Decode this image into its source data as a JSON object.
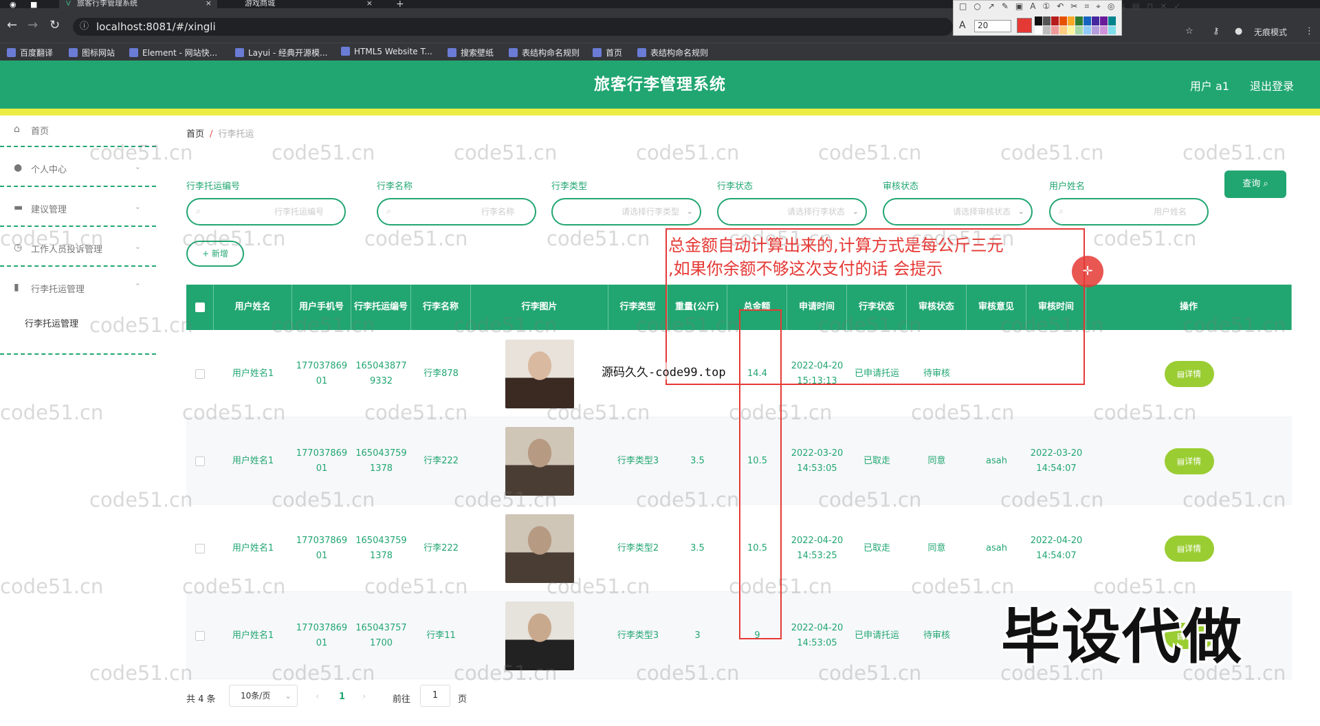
{
  "browser": {
    "tabs": [
      {
        "label": "旅客行李管理系统"
      },
      {
        "label": "游戏商城"
      }
    ],
    "tab_close": "×",
    "new_tab": "+",
    "url": "localhost:8081/#/xingli",
    "incognito_label": "无痕模式",
    "annot_font_size": "20",
    "annot_swatches": [
      "#111111",
      "#555555",
      "#b71c1c",
      "#e65100",
      "#f9a825",
      "#2e7d32",
      "#1565c0",
      "#4527a0",
      "#6a1b9a",
      "#00838f",
      "#ffffff",
      "#bdbdbd",
      "#ef9a9a",
      "#ffcc80",
      "#fff59d",
      "#a5d6a7",
      "#90caf9",
      "#b39ddb",
      "#ce93d8",
      "#80deea"
    ],
    "bookmarks": [
      "百度翻译",
      "图标网站",
      "Element - 网站快...",
      "Layui - 经典开源模...",
      "HTML5 Website T...",
      "搜索壁纸",
      "表结构命名规则",
      "首页",
      "表结构命名规则"
    ]
  },
  "header": {
    "title": "旅客行李管理系统",
    "user": "用户 a1",
    "logout": "退出登录"
  },
  "sidebar": {
    "items": [
      {
        "label": "首页"
      },
      {
        "label": "个人中心"
      },
      {
        "label": "建议管理"
      },
      {
        "label": "工作人员投诉管理"
      },
      {
        "label": "行李托运管理"
      }
    ],
    "subitem": "行李托运管理"
  },
  "breadcrumb": {
    "home": "首页",
    "sep": "/",
    "current": "行李托运"
  },
  "filters": [
    {
      "label": "行李托运编号",
      "placeholder": "行李托运编号"
    },
    {
      "label": "行李名称",
      "placeholder": "行李名称"
    },
    {
      "label": "行李类型",
      "placeholder": "请选择行李类型"
    },
    {
      "label": "行李状态",
      "placeholder": "请选择行李状态"
    },
    {
      "label": "审核状态",
      "placeholder": "请选择审核状态"
    },
    {
      "label": "用户姓名",
      "placeholder": "用户姓名"
    }
  ],
  "buttons": {
    "query": "查询",
    "add": "+ 新增",
    "detail": "详情"
  },
  "table": {
    "headers": [
      "用户姓名",
      "用户手机号",
      "行李托运编号",
      "行李名称",
      "行李图片",
      "行李类型",
      "重量(公斤)",
      "总金额",
      "申请时间",
      "行李状态",
      "审核状态",
      "审核意见",
      "审核时间",
      "操作"
    ],
    "rows": [
      {
        "name": "用户姓名1",
        "phone": "17703786901",
        "code": "1650438779332",
        "item": "行李878",
        "type": "",
        "weight": "",
        "total": "14.4",
        "apply_time": "2022-04-20 15:13:13",
        "status": "已申请托运",
        "audit": "待审核",
        "opinion": "",
        "audit_time": ""
      },
      {
        "name": "用户姓名1",
        "phone": "17703786901",
        "code": "1650437591378",
        "item": "行李222",
        "type": "行李类型3",
        "weight": "3.5",
        "total": "10.5",
        "apply_time": "2022-03-20 14:53:05",
        "status": "已取走",
        "audit": "同意",
        "opinion": "asah",
        "audit_time": "2022-03-20 14:54:07"
      },
      {
        "name": "用户姓名1",
        "phone": "17703786901",
        "code": "1650437591378",
        "item": "行李222",
        "type": "行李类型2",
        "weight": "3.5",
        "total": "10.5",
        "apply_time": "2022-04-20 14:53:25",
        "status": "已取走",
        "audit": "同意",
        "opinion": "asah",
        "audit_time": "2022-04-20 14:54:07"
      },
      {
        "name": "用户姓名1",
        "phone": "17703786901",
        "code": "1650437571700",
        "item": "行李11",
        "type": "行李类型3",
        "weight": "3",
        "total": "9",
        "apply_time": "2022-04-20 14:53:05",
        "status": "已申请托运",
        "audit": "待审核",
        "opinion": "",
        "audit_time": ""
      }
    ]
  },
  "pagination": {
    "total": "共 4 条",
    "page_size": "10条/页",
    "current": "1",
    "goto": "前往",
    "goto_value": "1",
    "page_suffix": "页"
  },
  "overlays": {
    "annotation_line1": "总金额自动计算出来的,计算方式是每公斤三元",
    "annotation_line2": ",如果你余额不够这次支付的话 会提示",
    "code_stamp": "源码久久-code99.top",
    "big_text": "毕设代做",
    "watermark": "code51.cn"
  },
  "colors": {
    "primary": "#21a671",
    "accent_yellow": "#ecec46",
    "detail_button": "#9acd32",
    "annotation": "#e53935"
  }
}
